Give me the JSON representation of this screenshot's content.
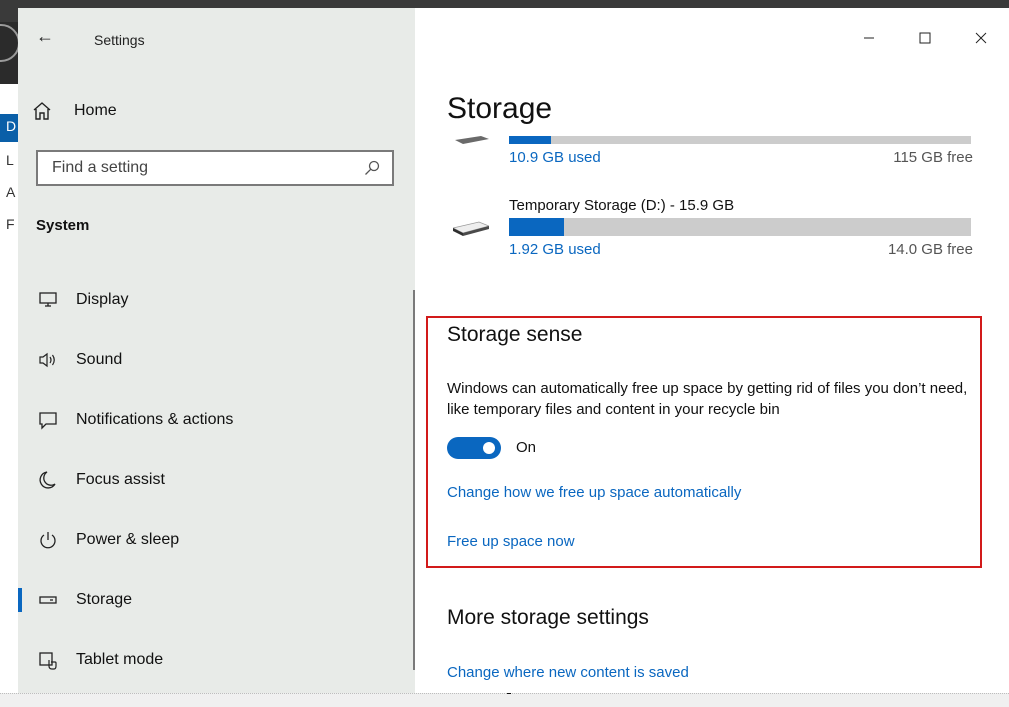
{
  "window": {
    "title": "Settings",
    "back_icon": "back-arrow-icon",
    "controls": [
      "minimize-icon",
      "maximize-icon",
      "close-icon"
    ]
  },
  "background_app": {
    "letters": [
      "D",
      "L",
      "A",
      "F"
    ]
  },
  "sidebar": {
    "home_label": "Home",
    "search_placeholder": "Find a setting",
    "section_title": "System",
    "items": [
      {
        "label": "Display",
        "icon": "monitor-icon"
      },
      {
        "label": "Sound",
        "icon": "speaker-icon"
      },
      {
        "label": "Notifications & actions",
        "icon": "notification-icon"
      },
      {
        "label": "Focus assist",
        "icon": "moon-icon"
      },
      {
        "label": "Power & sleep",
        "icon": "power-icon"
      },
      {
        "label": "Storage",
        "icon": "storage-drive-icon",
        "active": true
      },
      {
        "label": "Tablet mode",
        "icon": "tablet-mode-icon"
      }
    ]
  },
  "main": {
    "page_title": "Storage",
    "drives": [
      {
        "name": "",
        "used": "10.9 GB used",
        "free": "115 GB free",
        "used_fraction": 0.09
      },
      {
        "name": "Temporary Storage (D:) - 15.9 GB",
        "used": "1.92 GB used",
        "free": "14.0 GB free",
        "used_fraction": 0.12
      }
    ],
    "storage_sense": {
      "title": "Storage sense",
      "description": "Windows can automatically free up space by getting rid of files you don’t need, like temporary files and content in your recycle bin",
      "toggle_state": "On",
      "link_change": "Change how we free up space automatically",
      "link_free": "Free up space now"
    },
    "more_settings": {
      "title": "More storage settings",
      "link_change_location": "Change where new content is saved"
    }
  },
  "colors": {
    "accent": "#0a67c0",
    "highlight_border": "#d21a1a",
    "sidebar_bg": "#e8ebe8"
  }
}
